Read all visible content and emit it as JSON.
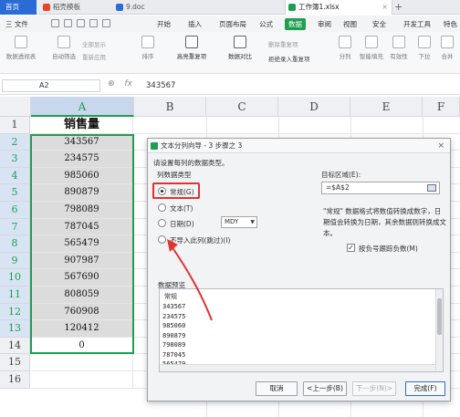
{
  "tabs": [
    {
      "label": "首页"
    },
    {
      "label": "稻壳模板"
    },
    {
      "label": "9.doc"
    },
    {
      "label": "工作簿1.xlsx"
    }
  ],
  "menu": {
    "file": "三 文件",
    "items": [
      "开始",
      "插入",
      "页面布局",
      "公式",
      "数据",
      "审阅",
      "视图",
      "安全",
      "开发工具",
      "特色"
    ],
    "active": "数据"
  },
  "ribbon": {
    "buttons": [
      "数据透视表",
      "自动筛选",
      "全部显示",
      "重新应用",
      "排序",
      "高亮重复项",
      "数据对比",
      "删除重复项",
      "拒绝录入重复项",
      "分列",
      "智能填充",
      "有效性",
      "下拉",
      "合并",
      "模拟",
      "记录",
      "创建",
      "取消"
    ]
  },
  "formula_bar": {
    "cell_ref": "A2",
    "fx": "fx",
    "value": "343567"
  },
  "sheet": {
    "columns": [
      "A",
      "B",
      "C",
      "D",
      "E",
      "F"
    ],
    "rows": [
      "1",
      "2",
      "3",
      "4",
      "5",
      "6",
      "7",
      "8",
      "9",
      "10",
      "11",
      "12",
      "13",
      "14",
      "15",
      "16"
    ],
    "header_cell": "销售量",
    "values": [
      "343567",
      "234575",
      "985060",
      "890879",
      "798089",
      "787045",
      "565479",
      "907987",
      "567690",
      "808059",
      "760908",
      "120412",
      "0"
    ]
  },
  "dialog": {
    "title": "文本分列向导 - 3 步骤之 3",
    "prompt": "请设置每列的数据类型。",
    "column_type_label": "列数据类型",
    "options": [
      "常规(G)",
      "文本(T)",
      "日期(D)",
      "不导入此列(跳过)(I)"
    ],
    "selected_option": "常规(G)",
    "date_format": "MDY",
    "target_label": "目标区域(E):",
    "target_value": "=$A$2",
    "help_text": [
      "\"常规\" 数据格式将数值转换成数字，日",
      "期值会转换为日期，其余数据则转换成文",
      "本。"
    ],
    "checkbox_label": "按负号跟踪负数(M)",
    "checkbox_checked": true,
    "preview_label": "数据预览",
    "preview_header": "常规",
    "preview_values": [
      "343567",
      "234575",
      "985060",
      "890879",
      "798089",
      "787045",
      "565479"
    ],
    "buttons": {
      "cancel": "取消",
      "back": "<上一步(B)",
      "next": "下一步(N)>",
      "finish": "完成(F)"
    }
  },
  "colors": {
    "accent_green": "#1e9e51",
    "highlight_red": "#e0332f",
    "home_blue": "#2b6bd6"
  }
}
